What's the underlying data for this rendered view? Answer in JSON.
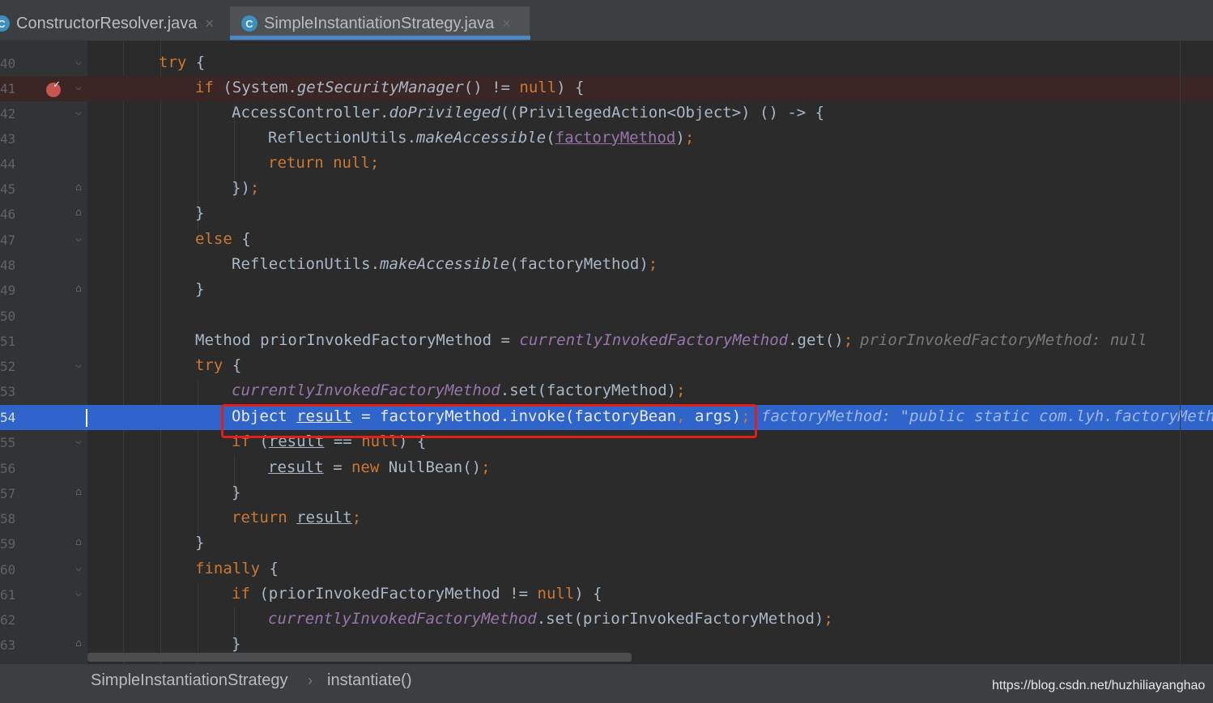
{
  "tabs": [
    {
      "label": "ConstructorResolver.java",
      "icon": "c-class-icon",
      "active": false
    },
    {
      "label": "SimpleInstantiationStrategy.java",
      "icon": "c-class-icon",
      "active": true
    }
  ],
  "tab_close_glyph": "×",
  "tab_icon_letter": "C",
  "colors": {
    "keyword": "#cc7832",
    "static_field": "#9876aa",
    "text": "#a9b7c6",
    "current_line": "#2f65ca",
    "highlight_box": "#e0201a"
  },
  "lines": [
    {
      "num": "40",
      "text": "try {"
    },
    {
      "num": "41",
      "text": "if (System.getSecurityManager() != null) {",
      "breakpoint": true
    },
    {
      "num": "42",
      "text": "AccessController.doPrivileged((PrivilegedAction<Object>) () -> {"
    },
    {
      "num": "43",
      "text": "ReflectionUtils.makeAccessible(factoryMethod);"
    },
    {
      "num": "44",
      "text": "return null;"
    },
    {
      "num": "45",
      "text": "});"
    },
    {
      "num": "46",
      "text": "}"
    },
    {
      "num": "47",
      "text": "else {"
    },
    {
      "num": "48",
      "text": "ReflectionUtils.makeAccessible(factoryMethod);"
    },
    {
      "num": "49",
      "text": "}"
    },
    {
      "num": "50",
      "text": ""
    },
    {
      "num": "51",
      "text": "Method priorInvokedFactoryMethod = currentlyInvokedFactoryMethod.get();",
      "inline": "priorInvokedFactoryMethod: null"
    },
    {
      "num": "52",
      "text": "try {"
    },
    {
      "num": "53",
      "text": "currentlyInvokedFactoryMethod.set(factoryMethod);"
    },
    {
      "num": "54",
      "text": "Object result = factoryMethod.invoke(factoryBean, args);",
      "inline": "factoryMethod: \"public static com.lyh.factoryMetho",
      "current": true
    },
    {
      "num": "55",
      "text": "if (result == null) {"
    },
    {
      "num": "56",
      "text": "result = new NullBean();"
    },
    {
      "num": "57",
      "text": "}"
    },
    {
      "num": "58",
      "text": "return result;"
    },
    {
      "num": "59",
      "text": "}"
    },
    {
      "num": "60",
      "text": "finally {"
    },
    {
      "num": "61",
      "text": "if (priorInvokedFactoryMethod != null) {"
    },
    {
      "num": "62",
      "text": "currentlyInvokedFactoryMethod.set(priorInvokedFactoryMethod);"
    },
    {
      "num": "63",
      "text": "}"
    }
  ],
  "breadcrumb": {
    "class_name": "SimpleInstantiationStrategy",
    "separator": "›",
    "method": "instantiate()"
  },
  "watermark": "https://blog.csdn.net/huzhiliayanghao"
}
